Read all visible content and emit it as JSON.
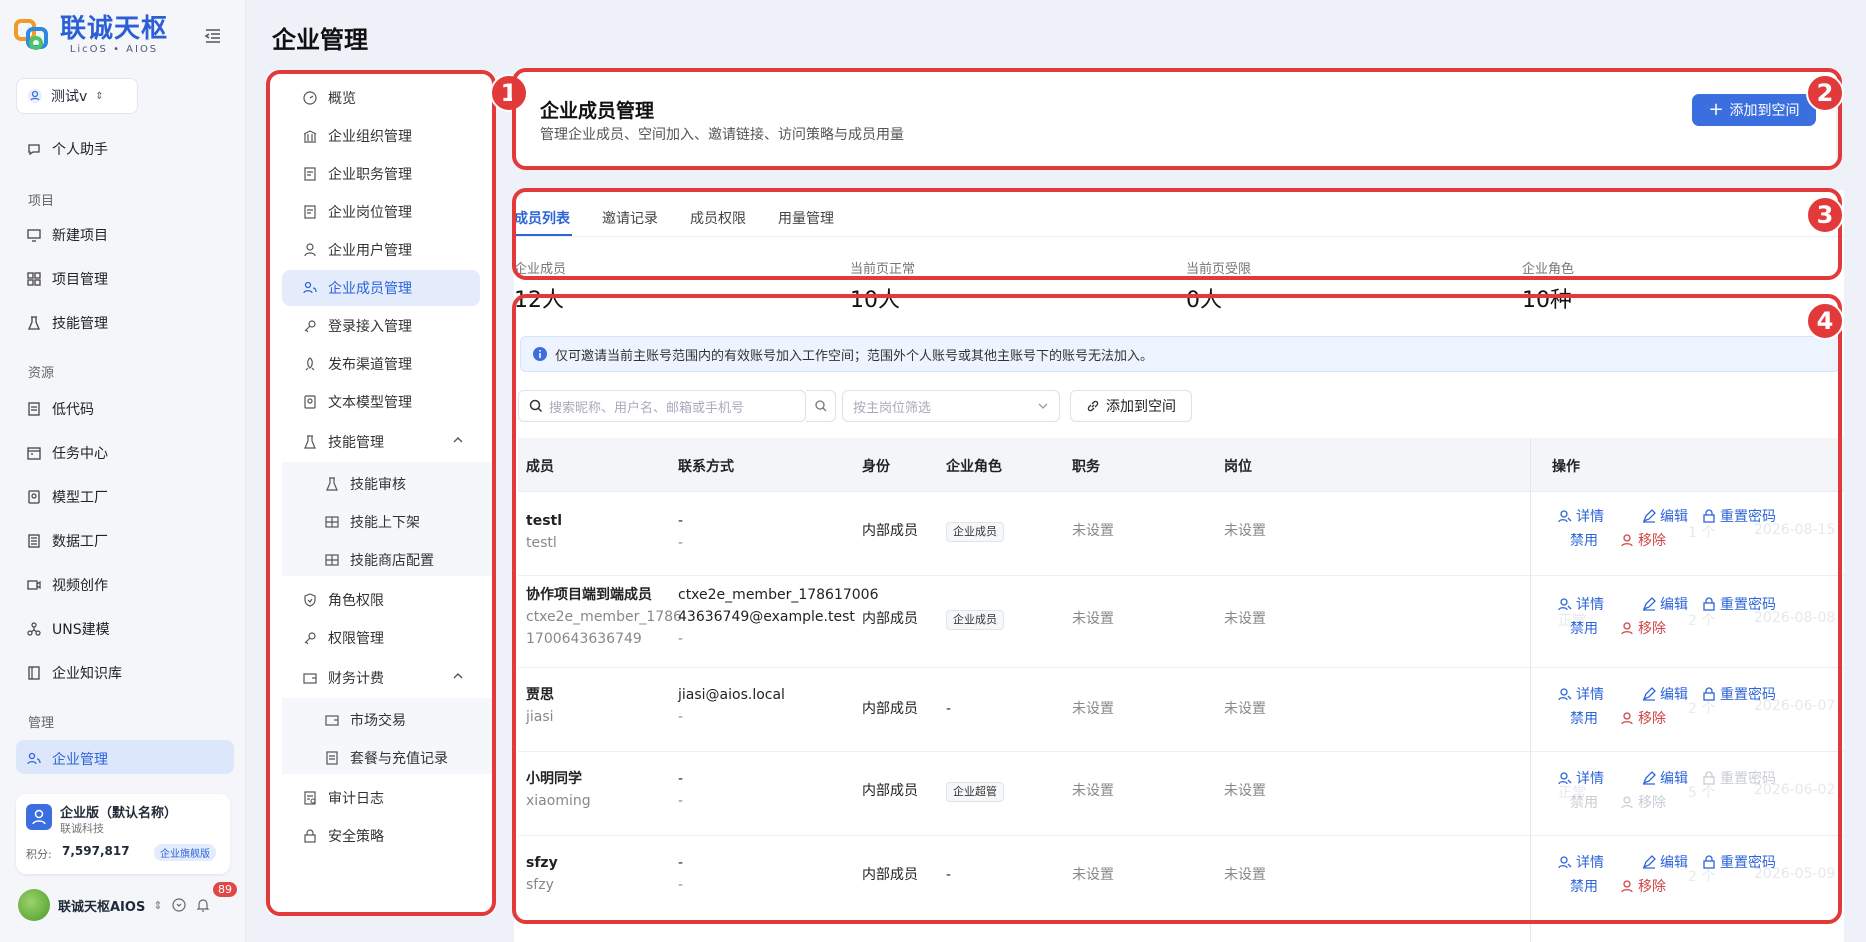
{
  "app": {
    "logo_title": "联诚天枢",
    "logo_sub": "LicOS • AIOS",
    "workspace": "测试v",
    "page_title": "企业管理"
  },
  "sidebar": {
    "assistant": "个人助手",
    "section_project": "项目",
    "new_project": "新建项目",
    "project_mgmt": "项目管理",
    "skill_mgmt": "技能管理",
    "section_resource": "资源",
    "lowcode": "低代码",
    "task_center": "任务中心",
    "model_factory": "模型工厂",
    "data_factory": "数据工厂",
    "video": "视频创作",
    "uns": "UNS建模",
    "kb": "企业知识库",
    "section_manage": "管理",
    "enterprise": "企业管理"
  },
  "enterprise_card": {
    "name": "企业版（默认名称）",
    "company": "联诚科技",
    "points_label": "积分:",
    "points": "7,597,817",
    "edition": "企业旗舰版"
  },
  "user": {
    "name": "联诚天枢AIOS",
    "notifications": "89"
  },
  "menu": {
    "overview": "概览",
    "org": "企业组织管理",
    "duty": "企业职务管理",
    "post": "企业岗位管理",
    "users": "企业用户管理",
    "members": "企业成员管理",
    "login": "登录接入管理",
    "channel": "发布渠道管理",
    "text_model": "文本模型管理",
    "skill": "技能管理",
    "skill_review": "技能审核",
    "skill_shelf": "技能上下架",
    "skill_store": "技能商店配置",
    "roles": "角色权限",
    "perm": "权限管理",
    "finance": "财务计费",
    "market": "市场交易",
    "plans": "套餐与充值记录",
    "audit": "审计日志",
    "security": "安全策略"
  },
  "header": {
    "title": "企业成员管理",
    "subtitle": "管理企业成员、空间加入、邀请链接、访问策略与成员用量",
    "add_button": "添加到空间"
  },
  "tabs": [
    "成员列表",
    "邀请记录",
    "成员权限",
    "用量管理"
  ],
  "stats": [
    {
      "label": "企业成员",
      "value": "12人"
    },
    {
      "label": "当前页正常",
      "value": "10人"
    },
    {
      "label": "当前页受限",
      "value": "0人"
    },
    {
      "label": "企业角色",
      "value": "10种"
    }
  ],
  "alert": "仅可邀请当前主账号范围内的有效账号加入工作空间；范围外个人账号或其他主账号下的账号无法加入。",
  "filters": {
    "search_placeholder": "搜索昵称、用户名、邮箱或手机号",
    "select_placeholder": "按主岗位筛选",
    "add_button": "添加到空间"
  },
  "table": {
    "headers": [
      "成员",
      "联系方式",
      "身份",
      "企业角色",
      "职务",
      "岗位",
      "操作"
    ],
    "ops": {
      "detail": "详情",
      "edit": "编辑",
      "reset": "重置密码",
      "disable": "禁用",
      "remove": "移除"
    },
    "rows": [
      {
        "name": "testl",
        "user": "testl",
        "contact1": "-",
        "contact2": "-",
        "contact3": "",
        "identity": "内部成员",
        "role": "企业成员",
        "duty": "未设置",
        "post": "未设置",
        "count": "1 个",
        "date": "2026-08-15",
        "status": "",
        "disabled": false
      },
      {
        "name": "协作项目端到端成员",
        "user": "ctxe2e_member_1786",
        "user2": "1700643636749",
        "contact1": "ctxe2e_member_178617006",
        "contact2": "43636749@example.test",
        "contact3": "-",
        "identity": "内部成员",
        "role": "企业成员",
        "duty": "未设置",
        "post": "未设置",
        "count": "2 个",
        "date": "2026-08-08",
        "status": "正常",
        "disabled": false
      },
      {
        "name": "贾思",
        "user": "jiasi",
        "contact1": "jiasi@aios.local",
        "contact2": "-",
        "contact3": "",
        "identity": "内部成员",
        "role": "-",
        "duty": "未设置",
        "post": "未设置",
        "count": "2 个",
        "date": "2026-06-07",
        "status": "",
        "disabled": false
      },
      {
        "name": "小明同学",
        "user": "xiaoming",
        "contact1": "-",
        "contact2": "-",
        "contact3": "",
        "identity": "内部成员",
        "role": "企业超管",
        "duty": "未设置",
        "post": "未设置",
        "count": "5 个",
        "date": "2026-06-02",
        "status": "正常",
        "disabled": true
      },
      {
        "name": "sfzy",
        "user": "sfzy",
        "contact1": "-",
        "contact2": "-",
        "contact3": "",
        "identity": "内部成员",
        "role": "-",
        "duty": "未设置",
        "post": "未设置",
        "count": "2 个",
        "date": "2026-05-09",
        "status": "",
        "disabled": false
      }
    ]
  },
  "annotations": [
    "1",
    "2",
    "3",
    "4"
  ]
}
